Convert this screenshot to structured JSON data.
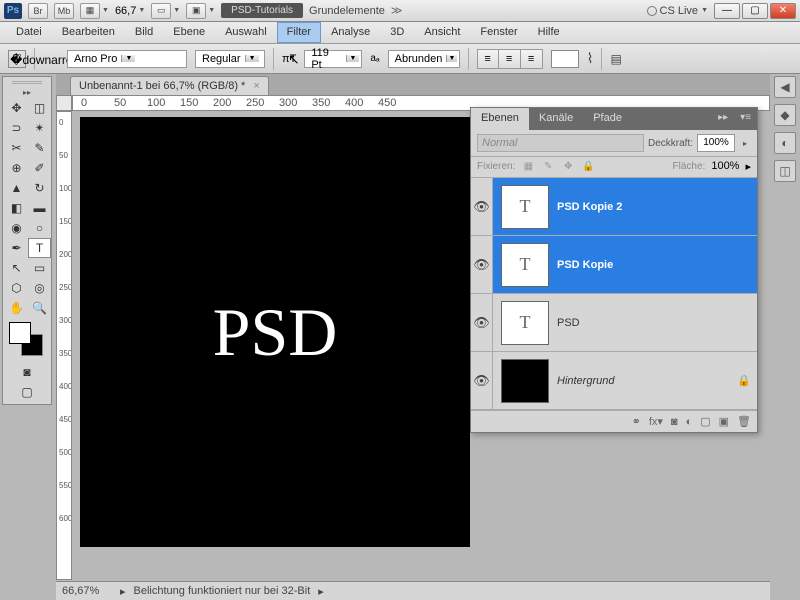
{
  "titlebar": {
    "ps": "Ps",
    "br": "Br",
    "mb": "Mb",
    "zoom": "66,7",
    "workspace_btn": "PSD-Tutorials",
    "workspace_label": "Grundelemente",
    "cslive": "CS Live"
  },
  "menu": [
    "Datei",
    "Bearbeiten",
    "Bild",
    "Ebene",
    "Auswahl",
    "Filter",
    "Analyse",
    "3D",
    "Ansicht",
    "Fenster",
    "Hilfe"
  ],
  "menu_hover_index": 5,
  "options": {
    "font": "Arno Pro",
    "weight": "Regular",
    "size": "119 Pt",
    "aa": "Abrunden"
  },
  "doc": {
    "tab": "Unbenannt-1 bei 66,7% (RGB/8) *"
  },
  "ruler_marks": [
    0,
    50,
    100,
    150,
    200,
    250,
    300,
    350,
    400,
    450
  ],
  "ruler_v": [
    0,
    50,
    100,
    150,
    200,
    250,
    300,
    350,
    400,
    450,
    500,
    550,
    600
  ],
  "canvas_text": "PSD",
  "layers_panel": {
    "tabs": [
      "Ebenen",
      "Kanäle",
      "Pfade"
    ],
    "blend": "Normal",
    "opacity_label": "Deckkraft:",
    "opacity": "100%",
    "lock_label": "Fixieren:",
    "fill_label": "Fläche:",
    "fill": "100%",
    "layers": [
      {
        "name": "PSD Kopie 2",
        "type": "T",
        "selected": true
      },
      {
        "name": "PSD Kopie",
        "type": "T",
        "selected": true
      },
      {
        "name": "PSD",
        "type": "T",
        "selected": false
      },
      {
        "name": "Hintergrund",
        "type": "bg",
        "selected": false,
        "locked": true
      }
    ]
  },
  "status": {
    "zoom": "66,67%",
    "msg": "Belichtung funktioniert nur bei 32-Bit"
  }
}
